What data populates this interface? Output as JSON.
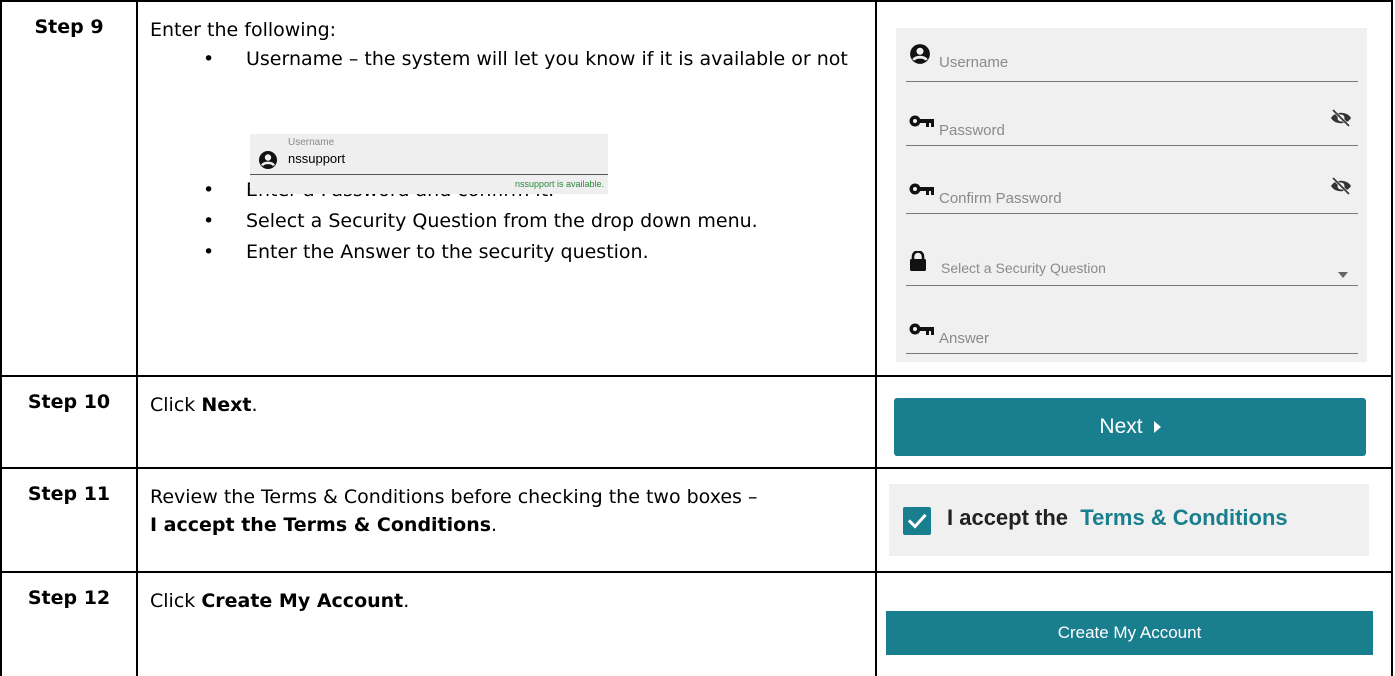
{
  "steps": [
    {
      "label": "Step 9",
      "intro": "Enter the following:",
      "bullets": [
        "Username – the system will let you know if it is available or not",
        "Enter a Password and confirm it.",
        "Select a Security Question from the drop down menu.",
        "Enter the Answer to the security question."
      ]
    },
    {
      "label": "Step 10",
      "pre": "Click ",
      "bold": "Next",
      "post": "."
    },
    {
      "label": "Step 11",
      "pre": "Review the Terms & Conditions before checking the two boxes –",
      "bold": "I accept the Terms & Conditions",
      "post": "."
    },
    {
      "label": "Step 12",
      "pre": "Click ",
      "bold": "Create My Account",
      "post": "."
    }
  ],
  "mini_example": {
    "label": "Username",
    "value": "nssupport",
    "status": "nssupport is available."
  },
  "form": {
    "username_placeholder": "Username",
    "password_placeholder": "Password",
    "confirm_placeholder": "Confirm Password",
    "question_placeholder": "Select a Security Question",
    "answer_placeholder": "Answer"
  },
  "next_label": "Next",
  "terms": {
    "prefix": "I accept the",
    "link": "Terms & Conditions",
    "checked": true
  },
  "create_label": "Create My Account",
  "colors": {
    "accent": "#197f8e",
    "available": "#2a8a3a",
    "panel": "#f0f0f0"
  }
}
